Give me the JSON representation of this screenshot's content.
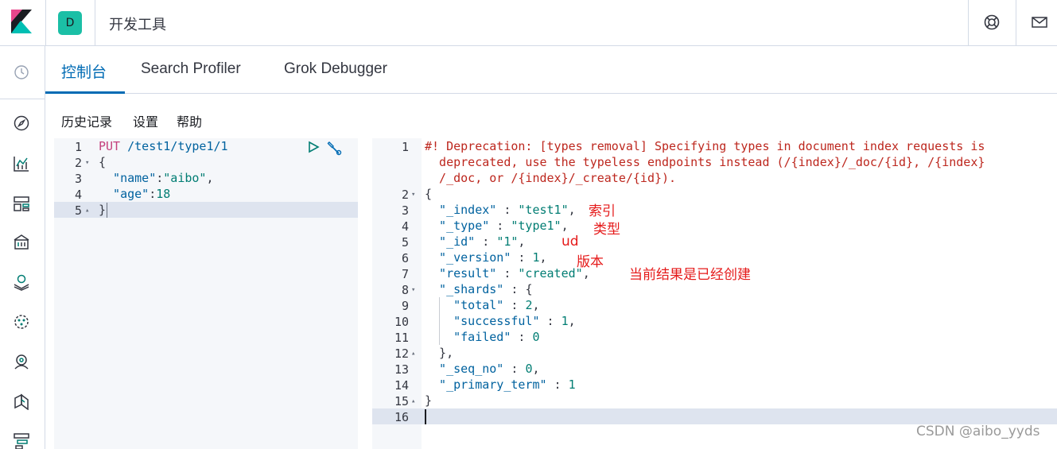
{
  "header": {
    "space_initial": "D",
    "app_title": "开发工具",
    "help_icon": "lifebuoy-icon",
    "mail_icon": "mail-icon",
    "logo_icon": "kibana-logo-icon"
  },
  "nav": {
    "items": [
      {
        "name": "recent-icon"
      },
      {
        "name": "discover-compass-icon"
      },
      {
        "name": "visualize-chart-icon"
      },
      {
        "name": "dashboard-icon"
      },
      {
        "name": "canvas-icon"
      },
      {
        "name": "maps-icon"
      },
      {
        "name": "ml-icon"
      },
      {
        "name": "metrics-icon"
      },
      {
        "name": "logs-icon"
      },
      {
        "name": "apm-icon"
      }
    ]
  },
  "tabs": [
    {
      "label": "控制台",
      "active": true
    },
    {
      "label": "Search Profiler",
      "active": false
    },
    {
      "label": "Grok Debugger",
      "active": false
    }
  ],
  "submenu": {
    "history": "历史记录",
    "settings": "设置",
    "help": "帮助"
  },
  "request_editor": {
    "run_icon": "play-icon",
    "wrench_icon": "wrench-icon",
    "line_numbers": [
      "1",
      "2",
      "3",
      "4",
      "5"
    ],
    "lines": {
      "l1_method": "PUT",
      "l1_url": " /test1/type1/1",
      "l2": "{",
      "l3_key": "  \"name\"",
      "l3_colon": ":",
      "l3_val": "\"aibo\"",
      "l3_end": ",",
      "l4_key": "  \"age\"",
      "l4_colon": ":",
      "l4_val": "18",
      "l5": "}"
    }
  },
  "response_editor": {
    "line_numbers": [
      "1",
      "2",
      "3",
      "4",
      "5",
      "6",
      "7",
      "8",
      "9",
      "10",
      "11",
      "12",
      "13",
      "14",
      "15",
      "16"
    ],
    "comment_1": "#! Deprecation: [types removal] Specifying types in document index requests is",
    "comment_2": "  deprecated, use the typeless endpoints instead (/{index}/_doc/{id}, /{index}",
    "comment_3": "  /_doc, or /{index}/_create/{id}).",
    "open_brace": "{",
    "index_key": "  \"_index\"",
    "index_val": "\"test1\"",
    "type_key": "  \"_type\"",
    "type_val": "\"type1\"",
    "id_key": "  \"_id\"",
    "id_val": "\"1\"",
    "version_key": "  \"_version\"",
    "version_val": "1",
    "result_key": "  \"result\"",
    "result_val": "\"created\"",
    "shards_key": "  \"_shards\"",
    "shards_open": "{",
    "total_key": "    \"total\"",
    "total_val": "2",
    "successful_key": "    \"successful\"",
    "successful_val": "1",
    "failed_key": "    \"failed\"",
    "failed_val": "0",
    "shards_close": "  },",
    "seq_key": "  \"_seq_no\"",
    "seq_val": "0",
    "term_key": "  \"_primary_term\"",
    "term_val": "1",
    "close_brace": "}",
    "sep": " : ",
    "comma": ","
  },
  "annotations": {
    "index": "索引",
    "type": "类型",
    "id": "ud",
    "version": "版本",
    "result": "当前结果是已经创建"
  },
  "watermark": "CSDN @aibo_yyds",
  "colors": {
    "accent": "#006bb4",
    "space_badge": "#1bbfa6",
    "annotation": "#e51a1a"
  }
}
